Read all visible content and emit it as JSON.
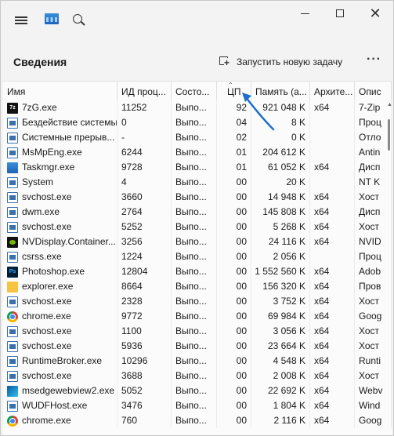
{
  "window": {
    "menu_icon": "hamburger-icon",
    "app_icon": "task-manager-icon",
    "search_icon": "search-icon",
    "minimize_icon": "minimize-icon",
    "maximize_icon": "maximize-icon",
    "close_glyph": "✕"
  },
  "cmdbar": {
    "title": "Сведения",
    "run_task_label": "Запустить новую задачу",
    "more_glyph": "···"
  },
  "columns": [
    "Имя",
    "ИД проц...",
    "Состо...",
    "ЦП",
    "Память (а...",
    "Архите...",
    "Опис"
  ],
  "rows": [
    {
      "icon": "7z",
      "name": "7zG.exe",
      "pid": "11252",
      "status": "Выпо...",
      "cpu": "92",
      "mem": "921 048 K",
      "arch": "x64",
      "desc": "7-Zip"
    },
    {
      "icon": "win",
      "name": "Бездействие системы",
      "pid": "0",
      "status": "Выпо...",
      "cpu": "04",
      "mem": "8 K",
      "arch": "",
      "desc": "Проц"
    },
    {
      "icon": "win",
      "name": "Системные прерыв...",
      "pid": "-",
      "status": "Выпо...",
      "cpu": "02",
      "mem": "0 K",
      "arch": "",
      "desc": "Отло"
    },
    {
      "icon": "win",
      "name": "MsMpEng.exe",
      "pid": "6244",
      "status": "Выпо...",
      "cpu": "01",
      "mem": "204 612 K",
      "arch": "",
      "desc": "Antin"
    },
    {
      "icon": "tm",
      "name": "Taskmgr.exe",
      "pid": "9728",
      "status": "Выпо...",
      "cpu": "01",
      "mem": "61 052 K",
      "arch": "x64",
      "desc": "Дисп"
    },
    {
      "icon": "win",
      "name": "System",
      "pid": "4",
      "status": "Выпо...",
      "cpu": "00",
      "mem": "20 K",
      "arch": "",
      "desc": "NT K"
    },
    {
      "icon": "win",
      "name": "svchost.exe",
      "pid": "3660",
      "status": "Выпо...",
      "cpu": "00",
      "mem": "14 948 K",
      "arch": "x64",
      "desc": "Хост"
    },
    {
      "icon": "win",
      "name": "dwm.exe",
      "pid": "2764",
      "status": "Выпо...",
      "cpu": "00",
      "mem": "145 808 K",
      "arch": "x64",
      "desc": "Дисп"
    },
    {
      "icon": "win",
      "name": "svchost.exe",
      "pid": "5252",
      "status": "Выпо...",
      "cpu": "00",
      "mem": "5 268 K",
      "arch": "x64",
      "desc": "Хост"
    },
    {
      "icon": "nv",
      "name": "NVDisplay.Container...",
      "pid": "3256",
      "status": "Выпо...",
      "cpu": "00",
      "mem": "24 116 K",
      "arch": "x64",
      "desc": "NVID"
    },
    {
      "icon": "win",
      "name": "csrss.exe",
      "pid": "1224",
      "status": "Выпо...",
      "cpu": "00",
      "mem": "2 056 K",
      "arch": "",
      "desc": "Проц"
    },
    {
      "icon": "ps",
      "name": "Photoshop.exe",
      "pid": "12804",
      "status": "Выпо...",
      "cpu": "00",
      "mem": "1 552 560 K",
      "arch": "x64",
      "desc": "Adob"
    },
    {
      "icon": "exp",
      "name": "explorer.exe",
      "pid": "8664",
      "status": "Выпо...",
      "cpu": "00",
      "mem": "156 320 K",
      "arch": "x64",
      "desc": "Пров"
    },
    {
      "icon": "win",
      "name": "svchost.exe",
      "pid": "2328",
      "status": "Выпо...",
      "cpu": "00",
      "mem": "3 752 K",
      "arch": "x64",
      "desc": "Хост"
    },
    {
      "icon": "chrome",
      "name": "chrome.exe",
      "pid": "9772",
      "status": "Выпо...",
      "cpu": "00",
      "mem": "69 984 K",
      "arch": "x64",
      "desc": "Goog"
    },
    {
      "icon": "win",
      "name": "svchost.exe",
      "pid": "1100",
      "status": "Выпо...",
      "cpu": "00",
      "mem": "3 056 K",
      "arch": "x64",
      "desc": "Хост"
    },
    {
      "icon": "win",
      "name": "svchost.exe",
      "pid": "5936",
      "status": "Выпо...",
      "cpu": "00",
      "mem": "23 664 K",
      "arch": "x64",
      "desc": "Хост"
    },
    {
      "icon": "win",
      "name": "RuntimeBroker.exe",
      "pid": "10296",
      "status": "Выпо...",
      "cpu": "00",
      "mem": "4 548 K",
      "arch": "x64",
      "desc": "Runti"
    },
    {
      "icon": "win",
      "name": "svchost.exe",
      "pid": "3688",
      "status": "Выпо...",
      "cpu": "00",
      "mem": "2 008 K",
      "arch": "x64",
      "desc": "Хост"
    },
    {
      "icon": "edge",
      "name": "msedgewebview2.exe",
      "pid": "5052",
      "status": "Выпо...",
      "cpu": "00",
      "mem": "22 692 K",
      "arch": "x64",
      "desc": "Webv"
    },
    {
      "icon": "win",
      "name": "WUDFHost.exe",
      "pid": "3476",
      "status": "Выпо...",
      "cpu": "00",
      "mem": "1 804 K",
      "arch": "x64",
      "desc": "Wind"
    },
    {
      "icon": "chrome",
      "name": "chrome.exe",
      "pid": "760",
      "status": "Выпо...",
      "cpu": "00",
      "mem": "2 116 K",
      "arch": "x64",
      "desc": "Goog"
    }
  ],
  "colors": {
    "accent": "#1f6fc9",
    "background": "#f3f3f3"
  }
}
